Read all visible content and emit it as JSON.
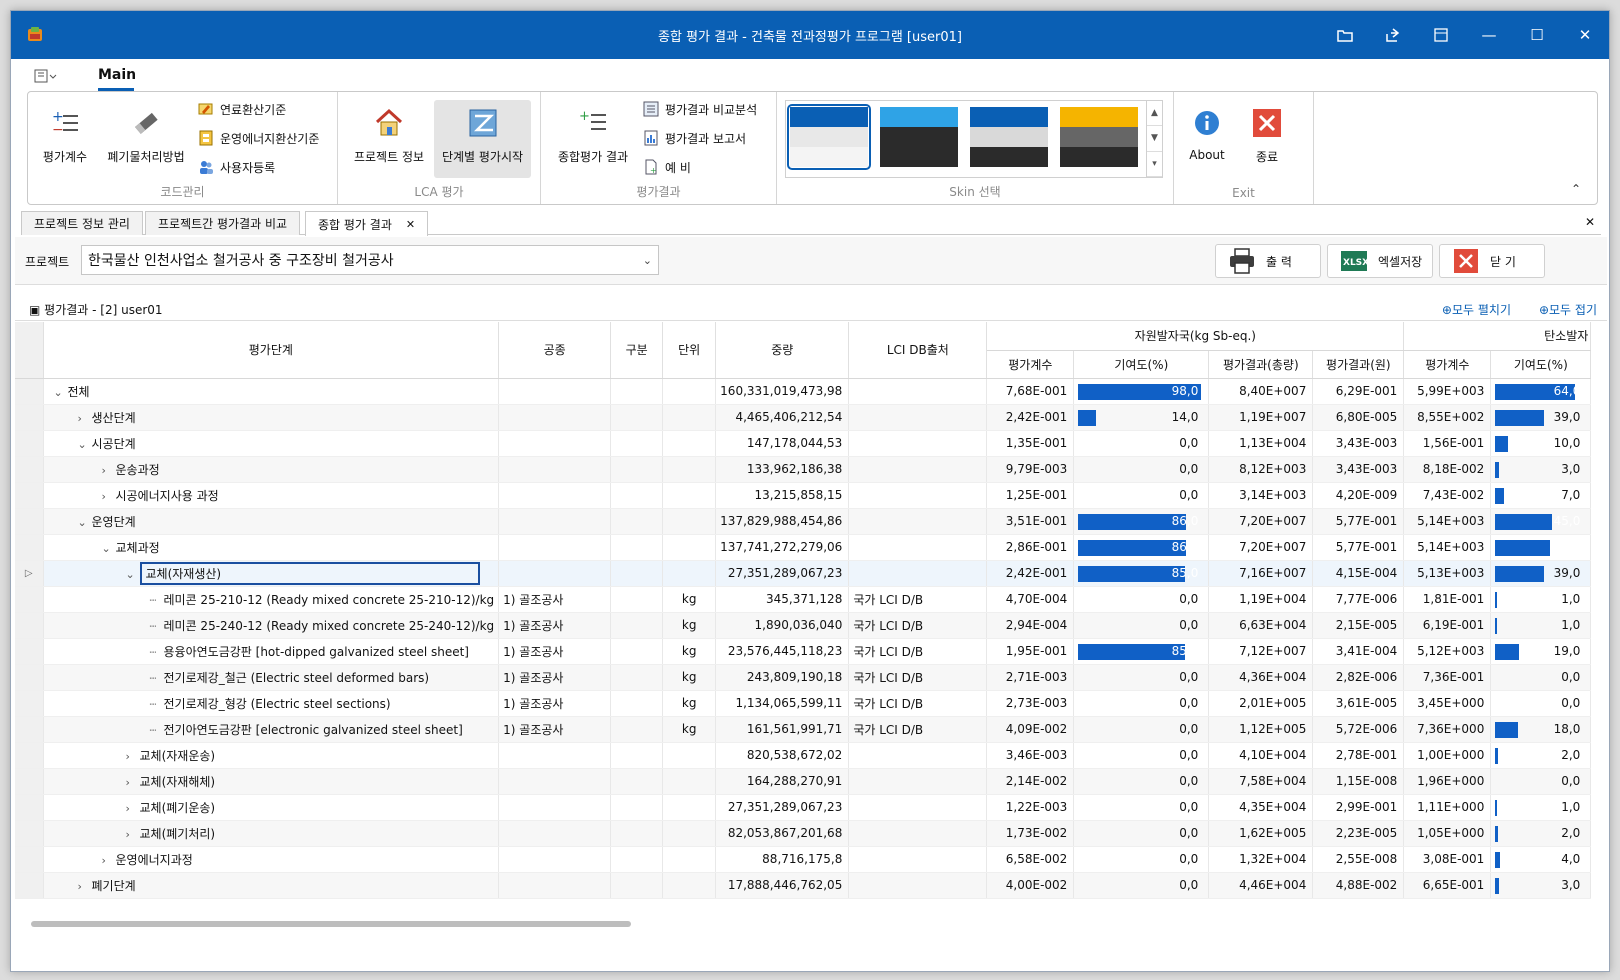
{
  "window": {
    "title": "종합 평가 결과 - 건축물 전과정평가 프로그램 [user01]"
  },
  "ribbon": {
    "tab": "Main",
    "groups": {
      "code": {
        "label": "코드관리",
        "big1": "평가계수",
        "big2": "폐기물처리방법",
        "small1": "연료환산기준",
        "small2": "운영에너지환산기준",
        "small3": "사용자등록"
      },
      "lca": {
        "label": "LCA 평가",
        "big1": "프로젝트 정보",
        "big2": "단계별 평가시작"
      },
      "result": {
        "label": "평가결과",
        "big1": "종합평가 결과",
        "small1": "평가결과 비교분석",
        "small2": "평가결과 보고서",
        "small3": "예 비"
      },
      "skin": {
        "label": "Skin 선택",
        "skins": [
          {
            "top": "#0a5fb4",
            "mid": "#e8e8e8",
            "bot": "#f4f4f4"
          },
          {
            "top": "#2fa3e6",
            "mid": "#2b2b2b",
            "bot": "#2b2b2b"
          },
          {
            "top": "#0a5fb4",
            "mid": "#d9d9d9",
            "bot": "#2b2b2b"
          },
          {
            "top": "#f5b400",
            "mid": "#666666",
            "bot": "#2b2b2b"
          }
        ]
      },
      "exit": {
        "label": "Exit",
        "about": "About",
        "close": "종료"
      }
    }
  },
  "doc_tabs": [
    "프로젝트 정보 관리",
    "프로젝트간 평가결과 비교",
    "종합 평가 결과"
  ],
  "toolbar": {
    "project_label": "프로젝트",
    "project_value": "한국물산 인천사업소 철거공사 중 구조장비 철거공사",
    "print": "출  력",
    "excel": "엑셀저장",
    "close": "닫  기"
  },
  "section": {
    "title": "평가결과  - [2] user01",
    "expand_all": "모두 펼치기",
    "collapse_all": "모두 접기"
  },
  "grid": {
    "headers": {
      "stage": "평가단계",
      "work": "공종",
      "category": "구분",
      "unit": "단위",
      "weight": "중량",
      "lci": "LCI DB출처",
      "group1": "자원발자국(kg Sb-eq.)",
      "g1_coef": "평가계수",
      "g1_contrib": "기여도(%)",
      "g1_total": "평가결과(총량)",
      "g1_won": "평가결과(원)",
      "group2": "탄소발자",
      "g2_coef": "평가계수",
      "g2_contrib": "기여도(%)"
    },
    "rows": [
      {
        "level": 0,
        "twisty": "⌄",
        "stage": "전체",
        "work": "",
        "unit": "",
        "weight": "160,331,019,473,98",
        "lci": "",
        "coef": "7,68E-001",
        "contrib": "98,0",
        "total": "8,40E+007",
        "won": "6,29E-001",
        "coef2": "5,99E+003",
        "contrib2": "64,0"
      },
      {
        "level": 1,
        "twisty": "›",
        "stage": "생산단계",
        "work": "",
        "unit": "",
        "weight": "4,465,406,212,54",
        "lci": "",
        "coef": "2,42E-001",
        "contrib": "14,0",
        "total": "1,19E+007",
        "won": "6,80E-005",
        "coef2": "8,55E+002",
        "contrib2": "39,0"
      },
      {
        "level": 1,
        "twisty": "⌄",
        "stage": "시공단계",
        "work": "",
        "unit": "",
        "weight": "147,178,044,53",
        "lci": "",
        "coef": "1,35E-001",
        "contrib": "0,0",
        "total": "1,13E+004",
        "won": "3,43E-003",
        "coef2": "1,56E-001",
        "contrib2": "10,0"
      },
      {
        "level": 2,
        "twisty": "›",
        "stage": "운송과정",
        "work": "",
        "unit": "",
        "weight": "133,962,186,38",
        "lci": "",
        "coef": "9,79E-003",
        "contrib": "0,0",
        "total": "8,12E+003",
        "won": "3,43E-003",
        "coef2": "8,18E-002",
        "contrib2": "3,0"
      },
      {
        "level": 2,
        "twisty": "›",
        "stage": "시공에너지사용 과정",
        "work": "",
        "unit": "",
        "weight": "13,215,858,15",
        "lci": "",
        "coef": "1,25E-001",
        "contrib": "0,0",
        "total": "3,14E+003",
        "won": "4,20E-009",
        "coef2": "7,43E-002",
        "contrib2": "7,0"
      },
      {
        "level": 1,
        "twisty": "⌄",
        "stage": "운영단계",
        "work": "",
        "unit": "",
        "weight": "137,829,988,454,86",
        "lci": "",
        "coef": "3,51E-001",
        "contrib": "86,0",
        "total": "7,20E+007",
        "won": "5,77E-001",
        "coef2": "5,14E+003",
        "contrib2": "45,0"
      },
      {
        "level": 2,
        "twisty": "⌄",
        "stage": "교체과정",
        "work": "",
        "unit": "",
        "weight": "137,741,272,279,06",
        "lci": "",
        "coef": "2,86E-001",
        "contrib": "86,0",
        "total": "7,20E+007",
        "won": "5,77E-001",
        "coef2": "5,14E+003",
        "contrib2": "44,0"
      },
      {
        "level": 3,
        "twisty": "⌄",
        "stage": "교체(자재생산)",
        "work": "",
        "unit": "",
        "weight": "27,351,289,067,23",
        "lci": "",
        "coef": "2,42E-001",
        "contrib": "85,0",
        "total": "7,16E+007",
        "won": "4,15E-004",
        "coef2": "5,13E+003",
        "contrib2": "39,0",
        "selected": true
      },
      {
        "level": 4,
        "twisty": "",
        "stage": "레미콘 25-210-12 (Ready mixed concrete 25-210-12)/kg",
        "work": "1) 골조공사",
        "unit": "kg",
        "weight": "345,371,128",
        "lci": "국가 LCI D/B",
        "coef": "4,70E-004",
        "contrib": "0,0",
        "total": "1,19E+004",
        "won": "7,77E-006",
        "coef2": "1,81E-001",
        "contrib2": "1,0"
      },
      {
        "level": 4,
        "twisty": "",
        "stage": "레미콘 25-240-12 (Ready mixed concrete 25-240-12)/kg",
        "work": "1) 골조공사",
        "unit": "kg",
        "weight": "1,890,036,040",
        "lci": "국가 LCI D/B",
        "coef": "2,94E-004",
        "contrib": "0,0",
        "total": "6,63E+004",
        "won": "2,15E-005",
        "coef2": "6,19E-001",
        "contrib2": "1,0"
      },
      {
        "level": 4,
        "twisty": "",
        "stage": "용융아연도금강판 [hot-dipped galvanized steel sheet]",
        "work": "1) 골조공사",
        "unit": "kg",
        "weight": "23,576,445,118,23",
        "lci": "국가 LCI D/B",
        "coef": "1,95E-001",
        "contrib": "85,0",
        "total": "7,12E+007",
        "won": "3,41E-004",
        "coef2": "5,12E+003",
        "contrib2": "19,0"
      },
      {
        "level": 4,
        "twisty": "",
        "stage": "전기로제강_철근 (Electric steel deformed bars)",
        "work": "1) 골조공사",
        "unit": "kg",
        "weight": "243,809,190,18",
        "lci": "국가 LCI D/B",
        "coef": "2,71E-003",
        "contrib": "0,0",
        "total": "4,36E+004",
        "won": "2,82E-006",
        "coef2": "7,36E-001",
        "contrib2": "0,0"
      },
      {
        "level": 4,
        "twisty": "",
        "stage": "전기로제강_형강 (Electric steel sections)",
        "work": "1) 골조공사",
        "unit": "kg",
        "weight": "1,134,065,599,11",
        "lci": "국가 LCI D/B",
        "coef": "2,73E-003",
        "contrib": "0,0",
        "total": "2,01E+005",
        "won": "3,61E-005",
        "coef2": "3,45E+000",
        "contrib2": "0,0"
      },
      {
        "level": 4,
        "twisty": "",
        "stage": "전기아연도금강판 [electronic galvanized steel sheet]",
        "work": "1) 골조공사",
        "unit": "kg",
        "weight": "161,561,991,71",
        "lci": "국가 LCI D/B",
        "coef": "4,09E-002",
        "contrib": "0,0",
        "total": "1,12E+005",
        "won": "5,72E-006",
        "coef2": "7,36E+000",
        "contrib2": "18,0"
      },
      {
        "level": 3,
        "twisty": "›",
        "stage": "교체(자재운송)",
        "work": "",
        "unit": "",
        "weight": "820,538,672,02",
        "lci": "",
        "coef": "3,46E-003",
        "contrib": "0,0",
        "total": "4,10E+004",
        "won": "2,78E-001",
        "coef2": "1,00E+000",
        "contrib2": "2,0"
      },
      {
        "level": 3,
        "twisty": "›",
        "stage": "교체(자재해체)",
        "work": "",
        "unit": "",
        "weight": "164,288,270,91",
        "lci": "",
        "coef": "2,14E-002",
        "contrib": "0,0",
        "total": "7,58E+004",
        "won": "1,15E-008",
        "coef2": "1,96E+000",
        "contrib2": "0,0"
      },
      {
        "level": 3,
        "twisty": "›",
        "stage": "교체(폐기운송)",
        "work": "",
        "unit": "",
        "weight": "27,351,289,067,23",
        "lci": "",
        "coef": "1,22E-003",
        "contrib": "0,0",
        "total": "4,35E+004",
        "won": "2,99E-001",
        "coef2": "1,11E+000",
        "contrib2": "1,0"
      },
      {
        "level": 3,
        "twisty": "›",
        "stage": "교체(폐기처리)",
        "work": "",
        "unit": "",
        "weight": "82,053,867,201,68",
        "lci": "",
        "coef": "1,73E-002",
        "contrib": "0,0",
        "total": "1,62E+005",
        "won": "2,23E-005",
        "coef2": "1,05E+000",
        "contrib2": "2,0"
      },
      {
        "level": 2,
        "twisty": "›",
        "stage": "운영에너지과정",
        "work": "",
        "unit": "",
        "weight": "88,716,175,8",
        "lci": "",
        "coef": "6,58E-002",
        "contrib": "0,0",
        "total": "1,32E+004",
        "won": "2,55E-008",
        "coef2": "3,08E-001",
        "contrib2": "4,0"
      },
      {
        "level": 1,
        "twisty": "›",
        "stage": "폐기단계",
        "work": "",
        "unit": "",
        "weight": "17,888,446,762,05",
        "lci": "",
        "coef": "4,00E-002",
        "contrib": "0,0",
        "total": "4,46E+004",
        "won": "4,88E-002",
        "coef2": "6,65E-001",
        "contrib2": "3,0"
      }
    ]
  },
  "colors": {
    "accent": "#0a5fb4",
    "bar": "#1060c6"
  }
}
